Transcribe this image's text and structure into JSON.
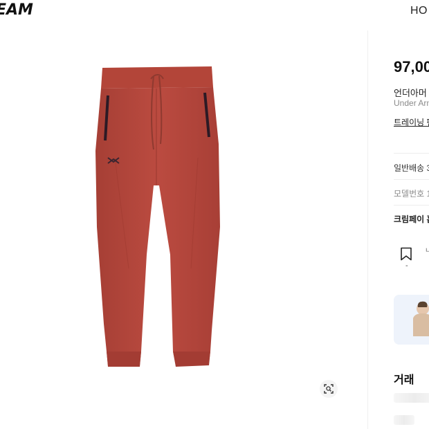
{
  "header": {
    "logo_text": "EAM",
    "nav_home": "HO"
  },
  "product": {
    "price": "97,00",
    "name_ko": "언더아머 .",
    "name_en": "Under Arm",
    "tag": "트레이닝 팬",
    "shipping": "일반배송 3",
    "model": "모델번호 1:",
    "pay": "크림페이 흠",
    "wish_count": "-",
    "tiny_text": "ㄴ 공"
  },
  "section": {
    "trade_title": "거래"
  },
  "icons": {
    "zoom": "zoom-scan-icon",
    "wishlist": "bookmark-icon"
  },
  "colors": {
    "pants": "#b84a3f",
    "banner_bg": "#eef3fb"
  }
}
